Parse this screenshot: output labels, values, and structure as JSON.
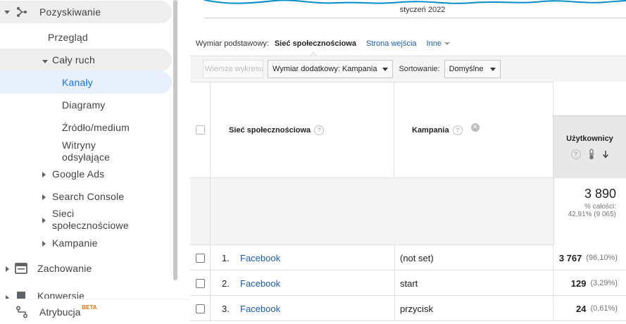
{
  "sidebar": {
    "section": "Pozyskiwanie",
    "items": [
      {
        "label": "Przegląd"
      },
      {
        "label": "Cały ruch"
      },
      {
        "label": "Kanały"
      },
      {
        "label": "Diagramy"
      },
      {
        "label": "Źródło/medium"
      },
      {
        "label": "Witryny\nodsyłające"
      },
      {
        "label": "Google Ads"
      },
      {
        "label": "Search Console"
      },
      {
        "label": "Sieci\nspołecznościowe"
      },
      {
        "label": "Kampanie"
      }
    ],
    "behaviour": "Zachowanie",
    "conversions": "Konwersje",
    "attribution": "Atrybucja",
    "beta": "BETA"
  },
  "chart": {
    "x_label": "styczeń 2022",
    "line_color": "#058dc7"
  },
  "dimensions": {
    "label": "Wymiar podstawowy:",
    "active": "Sieć społecznościowa",
    "other1": "Strona wejścia",
    "other2": "Inne"
  },
  "toolbar": {
    "plot_rows": "Wiersze wykresu",
    "secondary_dim": "Wymiar dodatkowy: Kampania",
    "sort_label": "Sortowanie:",
    "sort_value": "Domyślne"
  },
  "table": {
    "col_social": "Sieć społecznościowa",
    "col_campaign": "Kampania",
    "col_users": "Użytkownicy",
    "total_value": "3 890",
    "total_pct_label": "% całości:",
    "total_pct": "42,91% (9 065)",
    "rows": [
      {
        "num": "1.",
        "social": "Facebook",
        "campaign": "(not set)",
        "users": "3 767",
        "pct": "(96,10%)"
      },
      {
        "num": "2.",
        "social": "Facebook",
        "campaign": "start",
        "users": "129",
        "pct": "(3,29%)"
      },
      {
        "num": "3.",
        "social": "Facebook",
        "campaign": "przycisk",
        "users": "24",
        "pct": "(0,61%)"
      }
    ]
  }
}
